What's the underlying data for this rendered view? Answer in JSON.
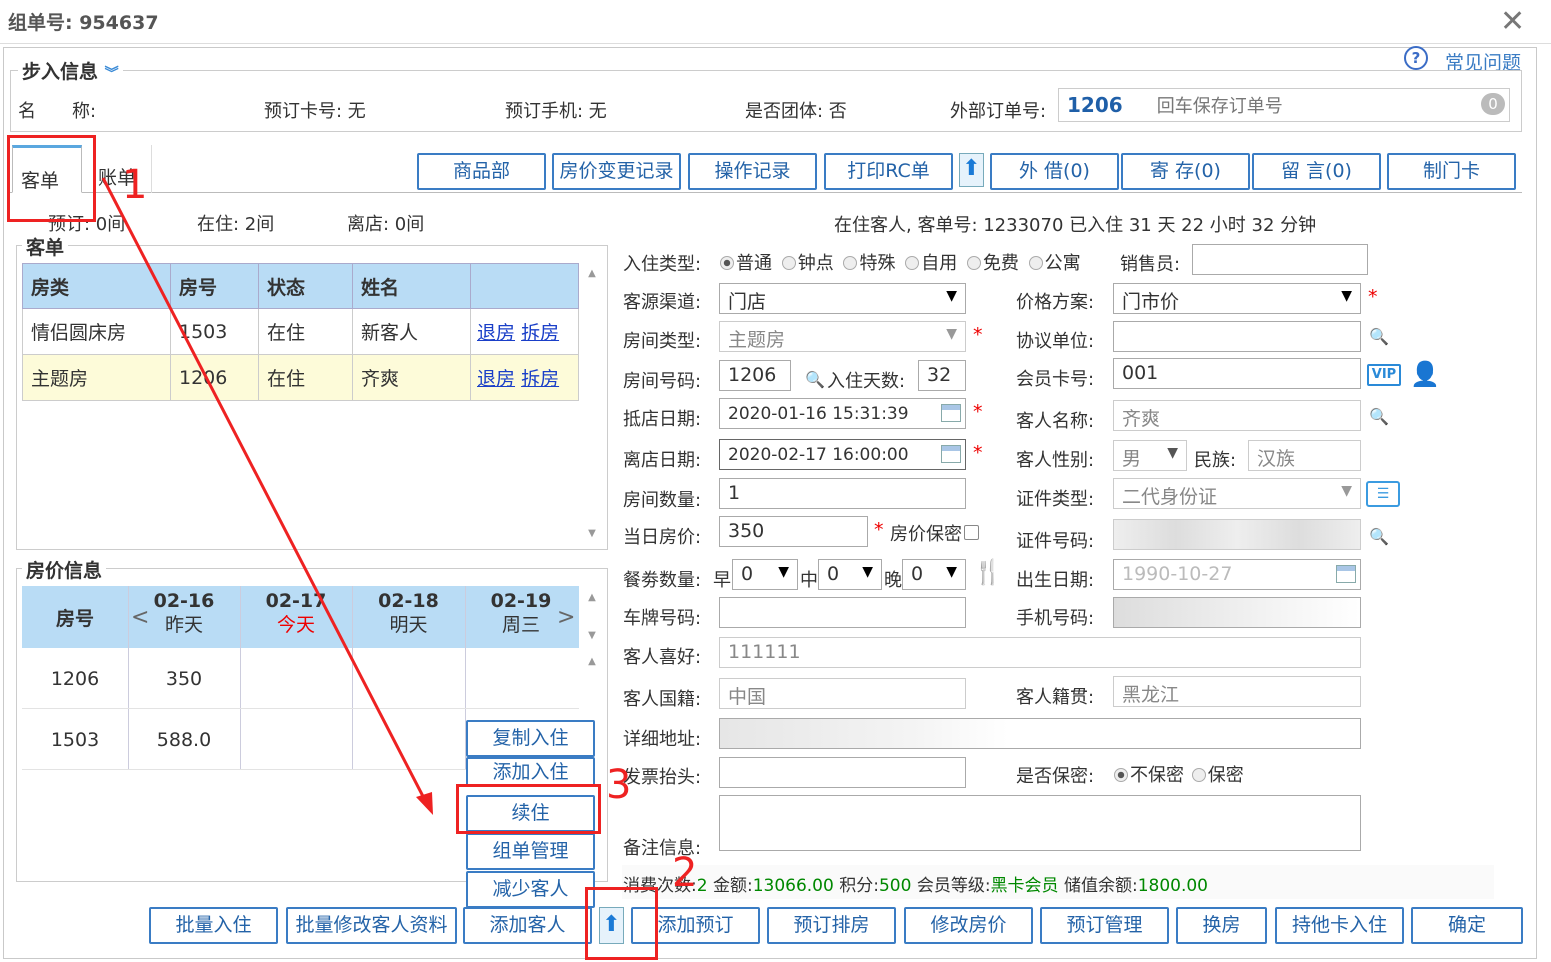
{
  "header": {
    "title": "组单号: 954637"
  },
  "help": {
    "label": "常见问题",
    "icon": "help-circle-icon"
  },
  "step": {
    "legend": "步入信息",
    "name_label": "名　　称:",
    "card_label": "预订卡号: 无",
    "phone_label": "预订手机: 无",
    "group_label": "是否团体: 否",
    "ext_label": "外部订单号:",
    "ext_value": "1206",
    "ext_placeholder": "回车保存订单号",
    "ext_badge": "0"
  },
  "tabs": [
    {
      "label": "客单"
    },
    {
      "label": "账单"
    }
  ],
  "toolbar": [
    "商品部",
    "房价变更记录",
    "操作记录",
    "打印RC单",
    "外 借(0)",
    "寄 存(0)",
    "留 言(0)",
    "制门卡"
  ],
  "summary": {
    "reserved": "预订: 0间",
    "inhouse": "在住: 2间",
    "left": "离店: 0间",
    "status_line": "在住客人, 客单号: 1233070 已入住 31 天 22 小时 32 分钟"
  },
  "guest_list": {
    "legend": "客单",
    "columns": [
      "房类",
      "房号",
      "状态",
      "姓名"
    ],
    "rows": [
      {
        "type": "情侣圆床房",
        "room": "1503",
        "status": "在住",
        "name": "新客人",
        "a1": "退房",
        "a2": "拆房"
      },
      {
        "type": "主题房",
        "room": "1206",
        "status": "在住",
        "name": "齐爽",
        "a1": "退房",
        "a2": "拆房"
      }
    ]
  },
  "rates": {
    "legend": "房价信息",
    "room_col": "房号",
    "days": [
      {
        "date": "02-16",
        "sub": "昨天"
      },
      {
        "date": "02-17",
        "sub": "今天"
      },
      {
        "date": "02-18",
        "sub": "明天"
      },
      {
        "date": "02-19",
        "sub": "周三"
      }
    ],
    "rows": [
      {
        "room": "1206",
        "v": "350"
      },
      {
        "room": "1503",
        "v": "588.0"
      }
    ]
  },
  "side_buttons": [
    "复制入住",
    "添加入住",
    "续住",
    "组单管理",
    "减少客人"
  ],
  "form": {
    "checkin_type_label": "入住类型:",
    "checkin_types": [
      "普通",
      "钟点",
      "特殊",
      "自用",
      "免费",
      "公寓"
    ],
    "sales_label": "销售员:",
    "source_label": "客源渠道:",
    "source": "门店",
    "price_plan_label": "价格方案:",
    "price_plan": "门市价",
    "room_type_label": "房间类型:",
    "room_type": "主题房",
    "agreement_label": "协议单位:",
    "room_no_label": "房间号码:",
    "room_no": "1206",
    "days_label": "入住天数:",
    "days": "32",
    "member_label": "会员卡号:",
    "member": "001",
    "vip": "VIP",
    "arrive_label": "抵店日期:",
    "arrive": "2020-01-16 15:31:39",
    "guest_name_label": "客人名称:",
    "guest_name": "齐爽",
    "depart_label": "离店日期:",
    "depart": "2020-02-17 16:00:00",
    "gender_label": "客人性别:",
    "gender": "男",
    "ethnic_label": "民族:",
    "ethnic": "汉族",
    "room_count_label": "房间数量:",
    "room_count": "1",
    "id_type_label": "证件类型:",
    "id_type": "二代身份证",
    "rate_label": "当日房价:",
    "rate": "350",
    "secret_label": "房价保密",
    "id_no_label": "证件号码:",
    "meal_label": "餐劵数量:",
    "meal_b": "早",
    "meal_l": "中",
    "meal_d": "晚",
    "meal_b_v": "0",
    "meal_l_v": "0",
    "meal_d_v": "0",
    "birth_label": "出生日期:",
    "birth": "1990-10-27",
    "plate_label": "车牌号码:",
    "mobile_label": "手机号码:",
    "pref_label": "客人喜好:",
    "pref": "111111",
    "nation_label": "客人国籍:",
    "nation": "中国",
    "hometown_label": "客人籍贯:",
    "hometown": "黑龙江",
    "address_label": "详细地址:",
    "invoice_label": "发票抬头:",
    "privacy_label": "是否保密:",
    "privacy_opts": [
      "不保密",
      "保密"
    ],
    "remark_label": "备注信息:"
  },
  "stats": {
    "count_label": "消费次数:",
    "count": "2",
    "amount_label": "金额:",
    "amount": "13066.00",
    "points_label": "积分:",
    "points": "500",
    "level_label": "会员等级:",
    "level": "黑卡会员",
    "balance_label": "储值余额:",
    "balance": "1800.00"
  },
  "bottom_buttons": [
    "批量入住",
    "批量修改客人资料",
    "添加客人",
    "添加预订",
    "预订排房",
    "修改房价",
    "预订管理",
    "换房",
    "持他卡入住",
    "确定"
  ],
  "annotations": [
    "1",
    "2",
    "3"
  ],
  "colors": {
    "accent": "#3a7cc4",
    "header_blue": "#b9dcf5",
    "annotation": "#e22"
  }
}
